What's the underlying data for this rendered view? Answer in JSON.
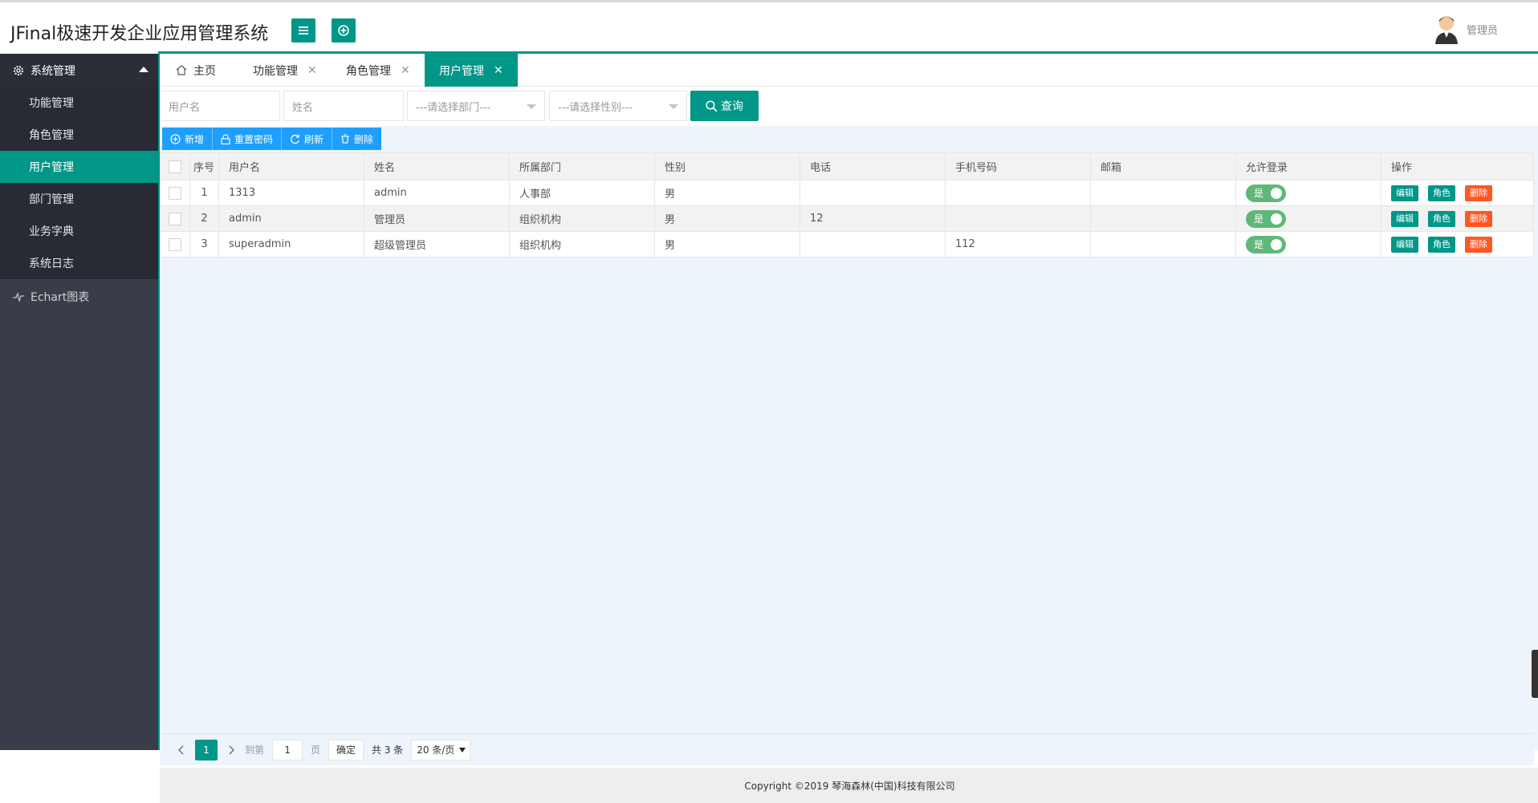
{
  "header": {
    "title": "JFinal极速开发企业应用管理系统",
    "user_name": "管理员"
  },
  "sidebar": {
    "group1": "系统管理",
    "items": [
      "功能管理",
      "角色管理",
      "用户管理",
      "部门管理",
      "业务字典",
      "系统日志"
    ],
    "group2": "Echart图表"
  },
  "tabs": [
    {
      "label": "主页"
    },
    {
      "label": "功能管理"
    },
    {
      "label": "角色管理"
    },
    {
      "label": "用户管理"
    }
  ],
  "search": {
    "username_placeholder": "用户名",
    "name_placeholder": "姓名",
    "dept_placeholder": "---请选择部门---",
    "gender_placeholder": "---请选择性别---",
    "query_label": "查询"
  },
  "toolbar": {
    "add": "新增",
    "reset_pwd": "重置密码",
    "refresh": "刷新",
    "delete": "删除"
  },
  "table": {
    "headers": [
      "序号",
      "用户名",
      "姓名",
      "所属部门",
      "性别",
      "电话",
      "手机号码",
      "邮箱",
      "允许登录",
      "操作"
    ],
    "rows": [
      {
        "no": "1",
        "username": "1313",
        "name": "admin",
        "dept": "人事部",
        "gender": "男",
        "phone": "",
        "mobile": "",
        "email": "",
        "login": "是"
      },
      {
        "no": "2",
        "username": "admin",
        "name": "管理员",
        "dept": "组织机构",
        "gender": "男",
        "phone": "12",
        "mobile": "",
        "email": "",
        "login": "是"
      },
      {
        "no": "3",
        "username": "superadmin",
        "name": "超级管理员",
        "dept": "组织机构",
        "gender": "男",
        "phone": "",
        "mobile": "112",
        "email": "",
        "login": "是"
      }
    ],
    "ops": {
      "edit": "编辑",
      "role": "角色",
      "delete": "删除"
    }
  },
  "pager": {
    "current": "1",
    "goto_label": "到第",
    "goto_value": "1",
    "page_label": "页",
    "confirm": "确定",
    "total": "共 3 条",
    "per_page": "20 条/页"
  },
  "footer": {
    "copyright": "Copyright ©2019 琴海森林(中国)科技有限公司"
  },
  "colors": {
    "accent": "#009688",
    "toolbar_blue": "#1e9fff",
    "danger": "#ff5722",
    "toggle_on": "#5fb878",
    "sidebar_bg": "#393d49"
  }
}
